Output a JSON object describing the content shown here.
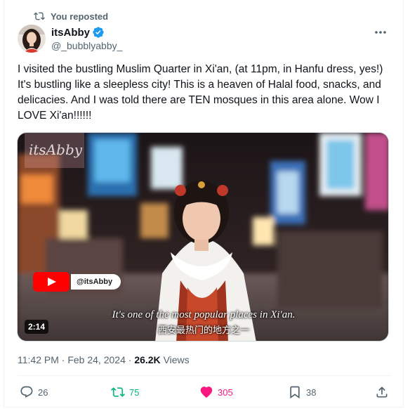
{
  "repost_label": "You reposted",
  "author": {
    "name": "itsAbby",
    "handle": "@_bubblyabby_"
  },
  "tweet_text": "I visited the bustling Muslim Quarter in Xi'an, (at 11pm, in Hanfu dress, yes!) It's bustling like a sleepless city! This is a heaven of Halal food, snacks, and delicacies. And I was told there are TEN mosques in this area alone. Wow I LOVE Xi'an!!!!!!",
  "media": {
    "duration": "2:14",
    "watermark": "itsAbby",
    "youtube_label": "@itsAbby",
    "subtitle_en": "It's one of the most popular places in Xi'an.",
    "subtitle_zh": "西安最热门的地方之一"
  },
  "meta": {
    "time": "11:42 PM",
    "separator": "·",
    "date": "Feb 24, 2024",
    "views_count": "26.2K",
    "views_label": "Views"
  },
  "actions": {
    "replies": "26",
    "reposts": "75",
    "likes": "305",
    "bookmarks": "38"
  },
  "colors": {
    "repost_green": "#00ba7c",
    "like_pink": "#f91880",
    "verified_blue": "#1d9bf0",
    "secondary_text": "#536471"
  },
  "icons": [
    "repost-icon",
    "verified-badge-icon",
    "more-icon",
    "reply-icon",
    "like-icon",
    "bookmark-icon",
    "share-icon",
    "youtube-icon"
  ]
}
